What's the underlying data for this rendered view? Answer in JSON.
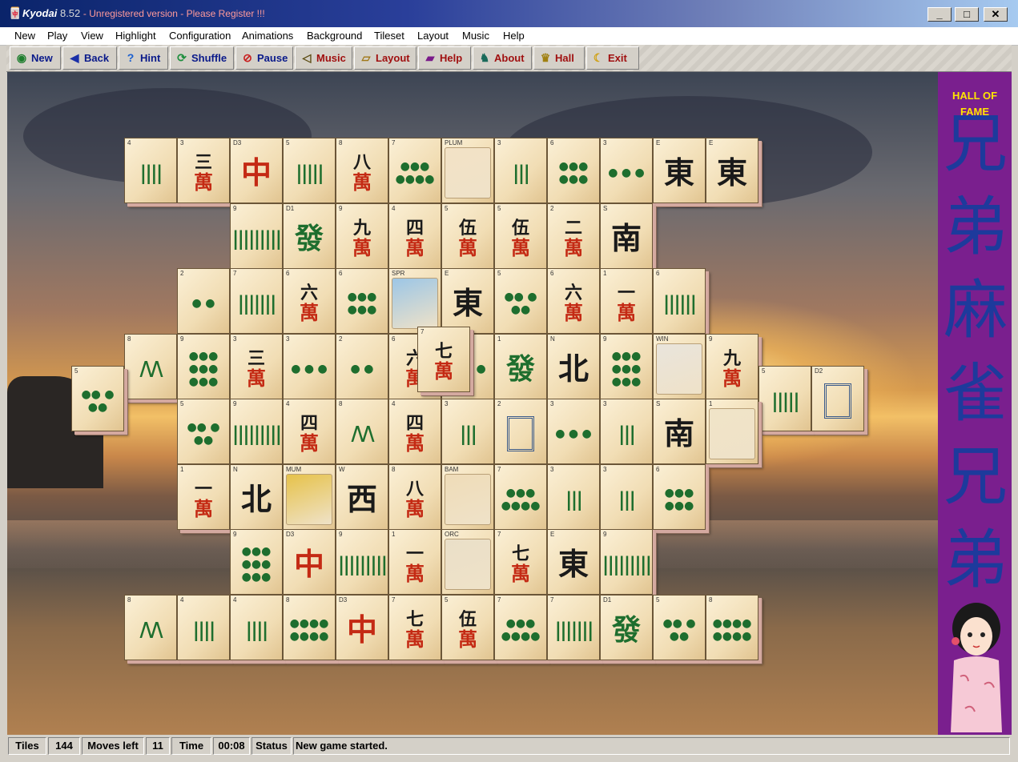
{
  "window": {
    "app_name": "Kyodai",
    "version": "8.52",
    "subtitle": "- Unregistered version - Please Register !!!"
  },
  "window_controls": {
    "minimize": "_",
    "maximize": "□",
    "close": "✕"
  },
  "menu": [
    "New",
    "Play",
    "View",
    "Highlight",
    "Configuration",
    "Animations",
    "Background",
    "Tileset",
    "Layout",
    "Music",
    "Help"
  ],
  "toolbar": [
    {
      "label": "New",
      "icon": "power-icon"
    },
    {
      "label": "Back",
      "icon": "back-arrow-icon"
    },
    {
      "label": "Hint",
      "icon": "question-icon"
    },
    {
      "label": "Shuffle",
      "icon": "shuffle-icon"
    },
    {
      "label": "Pause",
      "icon": "stop-icon"
    },
    {
      "label": "Music",
      "icon": "speaker-icon"
    },
    {
      "label": "Layout",
      "icon": "folder-icon"
    },
    {
      "label": "Help",
      "icon": "book-icon"
    },
    {
      "label": "About",
      "icon": "person-icon"
    },
    {
      "label": "Hall",
      "icon": "trophy-icon"
    },
    {
      "label": "Exit",
      "icon": "moon-icon"
    }
  ],
  "hall_of_fame": {
    "label_line1": "HALL OF",
    "label_line2": "FAME",
    "banner_chars": "兄弟麻雀兄弟"
  },
  "tiles": [
    {
      "row": 0,
      "col": 0,
      "lbl": "4",
      "kind": "bam",
      "face": "||||"
    },
    {
      "row": 0,
      "col": 1,
      "lbl": "3",
      "kind": "char",
      "top": "三",
      "bottom": "萬"
    },
    {
      "row": 0,
      "col": 2,
      "lbl": "D3",
      "kind": "red",
      "face": "中"
    },
    {
      "row": 0,
      "col": 3,
      "lbl": "5",
      "kind": "bam",
      "face": "|||||"
    },
    {
      "row": 0,
      "col": 4,
      "lbl": "8",
      "kind": "char",
      "top": "八",
      "bottom": "萬"
    },
    {
      "row": 0,
      "col": 5,
      "lbl": "7",
      "kind": "dots",
      "face": "●●● ●●●●"
    },
    {
      "row": 0,
      "col": 6,
      "lbl": "PLUM",
      "kind": "flower",
      "color": "#f3e2c6"
    },
    {
      "row": 0,
      "col": 7,
      "lbl": "3",
      "kind": "bam",
      "face": "|||"
    },
    {
      "row": 0,
      "col": 8,
      "lbl": "6",
      "kind": "dots",
      "face": "●●● ●●●"
    },
    {
      "row": 0,
      "col": 9,
      "lbl": "3",
      "kind": "dots",
      "face": "● ● ●"
    },
    {
      "row": 0,
      "col": 10,
      "lbl": "E",
      "kind": "wind",
      "face": "東"
    },
    {
      "row": 0,
      "col": 11,
      "lbl": "E",
      "kind": "wind",
      "face": "東"
    },
    {
      "row": 1,
      "col": 2,
      "lbl": "9",
      "kind": "bam",
      "face": "|||||||||"
    },
    {
      "row": 1,
      "col": 3,
      "lbl": "D1",
      "kind": "green",
      "face": "發"
    },
    {
      "row": 1,
      "col": 4,
      "lbl": "9",
      "kind": "char",
      "top": "九",
      "bottom": "萬"
    },
    {
      "row": 1,
      "col": 5,
      "lbl": "4",
      "kind": "char",
      "top": "四",
      "bottom": "萬"
    },
    {
      "row": 1,
      "col": 6,
      "lbl": "5",
      "kind": "char",
      "top": "伍",
      "bottom": "萬"
    },
    {
      "row": 1,
      "col": 7,
      "lbl": "5",
      "kind": "char",
      "top": "伍",
      "bottom": "萬"
    },
    {
      "row": 1,
      "col": 8,
      "lbl": "2",
      "kind": "char",
      "top": "二",
      "bottom": "萬"
    },
    {
      "row": 1,
      "col": 9,
      "lbl": "S",
      "kind": "wind",
      "face": "南"
    },
    {
      "row": 2,
      "col": 1,
      "lbl": "2",
      "kind": "dots",
      "face": "● ●"
    },
    {
      "row": 2,
      "col": 2,
      "lbl": "7",
      "kind": "bam",
      "face": "|||||||"
    },
    {
      "row": 2,
      "col": 3,
      "lbl": "6",
      "kind": "char",
      "top": "六",
      "bottom": "萬"
    },
    {
      "row": 2,
      "col": 4,
      "lbl": "6",
      "kind": "dots",
      "face": "●●● ●●●"
    },
    {
      "row": 2,
      "col": 5,
      "lbl": "SPR",
      "kind": "flower",
      "color": "#9cc6e6"
    },
    {
      "row": 2,
      "col": 6,
      "lbl": "E",
      "kind": "wind",
      "face": "東"
    },
    {
      "row": 2,
      "col": 7,
      "lbl": "5",
      "kind": "dots",
      "face": "●● ● ●●"
    },
    {
      "row": 2,
      "col": 8,
      "lbl": "6",
      "kind": "char",
      "top": "六",
      "bottom": "萬"
    },
    {
      "row": 2,
      "col": 9,
      "lbl": "1",
      "kind": "char",
      "top": "一",
      "bottom": "萬"
    },
    {
      "row": 2,
      "col": 10,
      "lbl": "6",
      "kind": "bam",
      "face": "||||||"
    },
    {
      "row": 3,
      "col": 0,
      "lbl": "8",
      "kind": "bam",
      "face": "/\\/\\"
    },
    {
      "row": 3,
      "col": 1,
      "lbl": "9",
      "kind": "dots",
      "face": "●●● ●●● ●●●"
    },
    {
      "row": 3,
      "col": 2,
      "lbl": "3",
      "kind": "char",
      "top": "三",
      "bottom": "萬"
    },
    {
      "row": 3,
      "col": 3,
      "lbl": "3",
      "kind": "dots",
      "face": "● ● ●"
    },
    {
      "row": 3,
      "col": 4,
      "lbl": "2",
      "kind": "dots",
      "face": "● ●"
    },
    {
      "row": 3,
      "col": 5,
      "lbl": "6",
      "kind": "char",
      "top": "六",
      "bottom": "萬"
    },
    {
      "row": 3,
      "col": 6,
      "lbl": "3",
      "kind": "dots",
      "face": "● ● ●"
    },
    {
      "row": 3,
      "col": 7,
      "lbl": "1",
      "kind": "green",
      "face": "發"
    },
    {
      "row": 3,
      "col": 8,
      "lbl": "N",
      "kind": "wind",
      "face": "北"
    },
    {
      "row": 3,
      "col": 9,
      "lbl": "9",
      "kind": "dots",
      "face": "●●● ●●● ●●●"
    },
    {
      "row": 3,
      "col": 10,
      "lbl": "WIN",
      "kind": "flower",
      "color": "#e9e4dc"
    },
    {
      "row": 3,
      "col": 11,
      "lbl": "9",
      "kind": "char",
      "top": "九",
      "bottom": "萬"
    },
    {
      "row": 3.5,
      "col": -1,
      "lbl": "5",
      "kind": "dots",
      "face": "●● ● ●●"
    },
    {
      "row": 3.5,
      "col": 12,
      "lbl": "5",
      "kind": "bam",
      "face": "|||||"
    },
    {
      "row": 3.5,
      "col": 13,
      "lbl": "D2",
      "kind": "white",
      "face": ""
    },
    {
      "row": 4,
      "col": 1,
      "lbl": "5",
      "kind": "dots",
      "face": "●● ● ●●"
    },
    {
      "row": 4,
      "col": 2,
      "lbl": "9",
      "kind": "bam",
      "face": "|||||||||"
    },
    {
      "row": 4,
      "col": 3,
      "lbl": "4",
      "kind": "char",
      "top": "四",
      "bottom": "萬"
    },
    {
      "row": 4,
      "col": 4,
      "lbl": "8",
      "kind": "bam",
      "face": "/\\/\\"
    },
    {
      "row": 4,
      "col": 5,
      "lbl": "4",
      "kind": "char",
      "top": "四",
      "bottom": "萬"
    },
    {
      "row": 4,
      "col": 6,
      "lbl": "3",
      "kind": "bam",
      "face": "|||"
    },
    {
      "row": 4,
      "col": 7,
      "lbl": "2",
      "kind": "white",
      "face": ""
    },
    {
      "row": 4,
      "col": 8,
      "lbl": "3",
      "kind": "dots",
      "face": "● ● ●"
    },
    {
      "row": 4,
      "col": 9,
      "lbl": "3",
      "kind": "bam",
      "face": "|||"
    },
    {
      "row": 4,
      "col": 10,
      "lbl": "S",
      "kind": "wind",
      "face": "南"
    },
    {
      "row": 4,
      "col": 11,
      "lbl": "1",
      "kind": "flower",
      "color": "#f0e4c8"
    },
    {
      "row": 5,
      "col": 1,
      "lbl": "1",
      "kind": "char",
      "top": "一",
      "bottom": "萬"
    },
    {
      "row": 5,
      "col": 2,
      "lbl": "N",
      "kind": "wind",
      "face": "北"
    },
    {
      "row": 5,
      "col": 3,
      "lbl": "MUM",
      "kind": "flower",
      "color": "#e6c24a"
    },
    {
      "row": 5,
      "col": 4,
      "lbl": "W",
      "kind": "wind",
      "face": "西"
    },
    {
      "row": 5,
      "col": 5,
      "lbl": "8",
      "kind": "char",
      "top": "八",
      "bottom": "萬"
    },
    {
      "row": 5,
      "col": 6,
      "lbl": "BAM",
      "kind": "flower",
      "color": "#efdcb8"
    },
    {
      "row": 5,
      "col": 7,
      "lbl": "7",
      "kind": "dots",
      "face": "●●● ●●●●"
    },
    {
      "row": 5,
      "col": 8,
      "lbl": "3",
      "kind": "bam",
      "face": "|||"
    },
    {
      "row": 5,
      "col": 9,
      "lbl": "3",
      "kind": "bam",
      "face": "|||"
    },
    {
      "row": 5,
      "col": 10,
      "lbl": "6",
      "kind": "dots",
      "face": "●●● ●●●"
    },
    {
      "row": 6,
      "col": 2,
      "lbl": "9",
      "kind": "dots",
      "face": "●●● ●●● ●●●"
    },
    {
      "row": 6,
      "col": 3,
      "lbl": "D3",
      "kind": "red",
      "face": "中"
    },
    {
      "row": 6,
      "col": 4,
      "lbl": "9",
      "kind": "bam",
      "face": "|||||||||"
    },
    {
      "row": 6,
      "col": 5,
      "lbl": "1",
      "kind": "char",
      "top": "一",
      "bottom": "萬"
    },
    {
      "row": 6,
      "col": 6,
      "lbl": "ORC",
      "kind": "flower",
      "color": "#eadfc8"
    },
    {
      "row": 6,
      "col": 7,
      "lbl": "7",
      "kind": "char",
      "top": "七",
      "bottom": "萬"
    },
    {
      "row": 6,
      "col": 8,
      "lbl": "E",
      "kind": "wind",
      "face": "東"
    },
    {
      "row": 6,
      "col": 9,
      "lbl": "9",
      "kind": "bam",
      "face": "|||||||||"
    },
    {
      "row": 7,
      "col": 0,
      "lbl": "8",
      "kind": "bam",
      "face": "/\\/\\"
    },
    {
      "row": 7,
      "col": 1,
      "lbl": "4",
      "kind": "bam",
      "face": "||||"
    },
    {
      "row": 7,
      "col": 2,
      "lbl": "4",
      "kind": "bam",
      "face": "||||"
    },
    {
      "row": 7,
      "col": 3,
      "lbl": "8",
      "kind": "dots",
      "face": "●●●● ●●●●"
    },
    {
      "row": 7,
      "col": 4,
      "lbl": "D3",
      "kind": "red",
      "face": "中"
    },
    {
      "row": 7,
      "col": 5,
      "lbl": "7",
      "kind": "char",
      "top": "七",
      "bottom": "萬"
    },
    {
      "row": 7,
      "col": 6,
      "lbl": "5",
      "kind": "char",
      "top": "伍",
      "bottom": "萬"
    },
    {
      "row": 7,
      "col": 7,
      "lbl": "7",
      "kind": "dots",
      "face": "●●● ●●●●"
    },
    {
      "row": 7,
      "col": 8,
      "lbl": "7",
      "kind": "bam",
      "face": "|||||||"
    },
    {
      "row": 7,
      "col": 9,
      "lbl": "D1",
      "kind": "green",
      "face": "發"
    },
    {
      "row": 7,
      "col": 10,
      "lbl": "5",
      "kind": "dots",
      "face": "●● ● ●●"
    },
    {
      "row": 7,
      "col": 11,
      "lbl": "8",
      "kind": "dots",
      "face": "●●●● ●●●●"
    },
    {
      "row": 2.9,
      "col": 5.55,
      "lbl": "7",
      "kind": "char",
      "top": "七",
      "bottom": "萬"
    }
  ],
  "status": {
    "tiles_label": "Tiles",
    "tiles_value": "144",
    "moves_label": "Moves left",
    "moves_value": "11",
    "time_label": "Time",
    "time_value": "00:08",
    "status_label": "Status",
    "status_value": "New game started."
  }
}
